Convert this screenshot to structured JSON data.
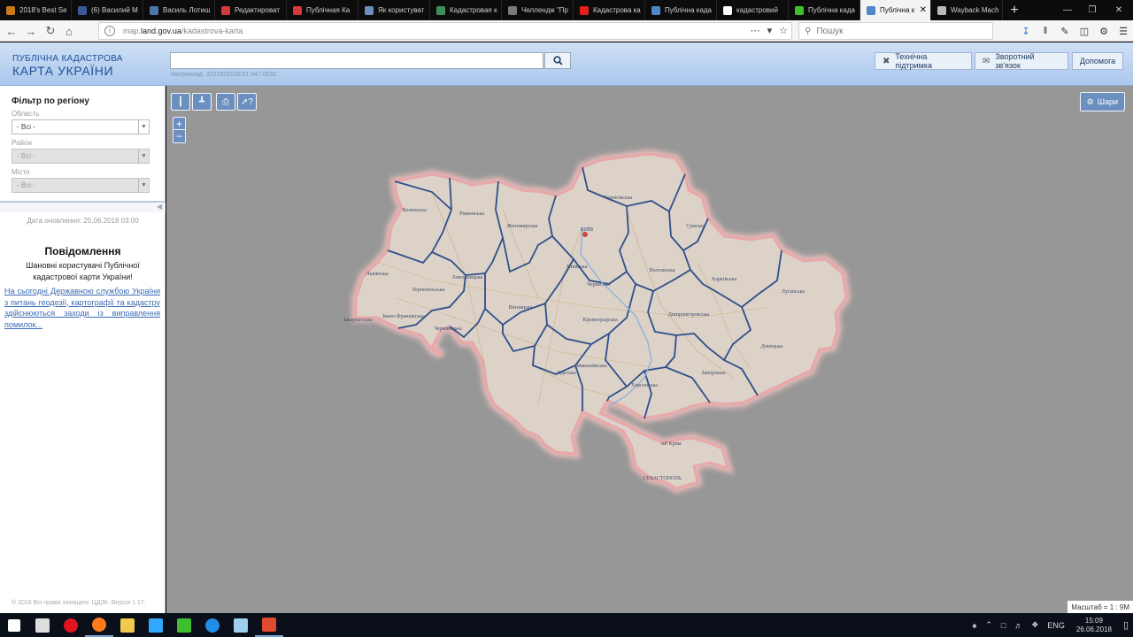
{
  "browser": {
    "tabs": [
      {
        "title": "2018's Best Sel",
        "icon": "book-icon",
        "color": "#c77b16"
      },
      {
        "title": "(6) Василий М",
        "icon": "facebook-icon",
        "color": "#3b5998"
      },
      {
        "title": "Василь Лотиш",
        "icon": "vk-icon",
        "color": "#4a76a8"
      },
      {
        "title": "Редактироват",
        "icon": "document-icon",
        "color": "#d23b3b"
      },
      {
        "title": "Публічная Ка",
        "icon": "document-icon",
        "color": "#d23b3b"
      },
      {
        "title": "Як користуват",
        "icon": "image-icon",
        "color": "#6a8fbf"
      },
      {
        "title": "Кадастровая к",
        "icon": "map-icon",
        "color": "#3d8f5a"
      },
      {
        "title": "Челлендж \"Пр",
        "icon": "chat-icon",
        "color": "#7a7a7a"
      },
      {
        "title": "Кадастрова ка",
        "icon": "youtube-icon",
        "color": "#e62117"
      },
      {
        "title": "Публічна када",
        "icon": "flag-icon",
        "color": "#4f86c6"
      },
      {
        "title": "кадастровий",
        "icon": "google-icon",
        "color": "#ffffff"
      },
      {
        "title": "Публічна када",
        "icon": "z-icon",
        "color": "#3fbf2f"
      },
      {
        "title": "Публічна к",
        "icon": "flag-icon",
        "color": "#4f86c6",
        "active": true
      },
      {
        "title": "Wayback Mach",
        "icon": "archive-icon",
        "color": "#bbbbbb"
      }
    ],
    "new_tab": "+",
    "url_prefix": "map.",
    "url_host": "land.gov.ua",
    "url_path": "/kadastrova-karta",
    "search_placeholder": "Пошук"
  },
  "site": {
    "logo_line1": "ПУБЛІЧНА КАДАСТРОВА",
    "logo_line2": "КАРТА УКРАЇНИ",
    "search_hint": "Наприклад: 3221655100:01:047:0032",
    "buttons": {
      "support": "Технічна підтримка",
      "feedback": "Зворотний зв'язок",
      "help": "Допомога"
    }
  },
  "sidebar": {
    "filter_title": "Фільтр по регіону",
    "oblast_label": "Область",
    "oblast_value": "- Всі -",
    "raion_label": "Район",
    "raion_value": "- Всі -",
    "city_label": "Місто",
    "city_value": "- Всі -",
    "updated": "Дата оновлення: 25.06.2018 03:00",
    "notice_title": "Повідомлення",
    "notice_text": "Шановні користувачі Публічної кадастрової карти України!",
    "notice_link": "На сьогодні Державною службою України з питань геодезії, картографії та кадастру здійснюються заходи із виправлення помилок...",
    "copyright": "© 2016 Всі права захищені. ЦДЗК. Версія 1.17."
  },
  "map": {
    "layers_label": "Шари",
    "scale": "Масштаб = 1 : 9М",
    "zoom_in": "+",
    "zoom_out": "−",
    "labels": {
      "volyn": "Волинська",
      "rivne": "Рівненська",
      "zhytomyr": "Житомирська",
      "chernihiv": "Чернігівська",
      "sumy": "Сумська",
      "kyiv_city": "КИЇВ",
      "kyiv_obl": "Київська",
      "lviv": "Львівська",
      "ternopil": "Тернопільська",
      "khmelnytskyi": "Хмельницька",
      "vinnytsia": "Вінницька",
      "cherkasy": "Черкаська",
      "poltava": "Полтавська",
      "kharkiv": "Харківська",
      "luhansk": "Луганська",
      "zakarpattia": "Закарпатська",
      "ivano_frankivsk": "Івано-Франківська",
      "chernivtsi": "Чернівецька",
      "kirovohrad": "Кіровоградська",
      "dnipro": "Дніпропетровська",
      "donetsk": "Донецька",
      "mykolaiv": "Миколаївська",
      "odesa": "Одеська",
      "kherson": "Херсонська",
      "zaporizhzhia": "Запорізька",
      "crimea": "АР Крим",
      "sevastopol": "СЕВАСТОПОЛЬ"
    }
  },
  "taskbar": {
    "apps": [
      {
        "name": "windows-start-icon",
        "color": "#ffffff"
      },
      {
        "name": "task-view-icon",
        "color": "#dddddd"
      },
      {
        "name": "opera-icon",
        "color": "#e0141e"
      },
      {
        "name": "firefox-icon",
        "color": "#ff7a1a",
        "open": true
      },
      {
        "name": "file-explorer-icon",
        "color": "#f2c94c"
      },
      {
        "name": "photoshop-icon",
        "color": "#31a8ff"
      },
      {
        "name": "camtasia-icon",
        "color": "#3fbf2f"
      },
      {
        "name": "edge-icon",
        "color": "#1f8ee6"
      },
      {
        "name": "app-icon",
        "color": "#9fd0f0"
      },
      {
        "name": "snagit-icon",
        "color": "#e04a2f",
        "open": true
      }
    ],
    "lang": "ENG",
    "time": "15:09",
    "date": "26.06.2018"
  }
}
